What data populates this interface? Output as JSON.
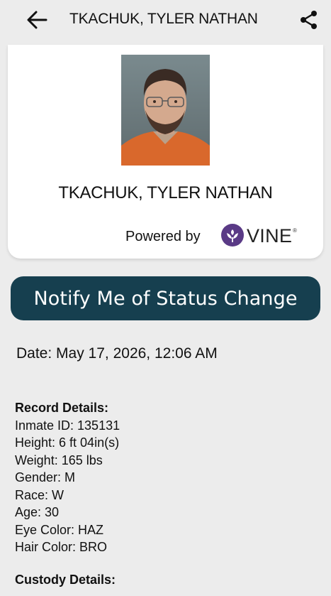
{
  "header": {
    "title": "TKACHUK, TYLER NATHAN"
  },
  "card": {
    "name": "TKACHUK, TYLER NATHAN",
    "powered_by": "Powered by",
    "brand": "VINE",
    "brand_mark": "®",
    "brand_color": "#5a3a86"
  },
  "notify_button": {
    "label": "Notify Me of Status Change",
    "color": "#163f4f"
  },
  "date": {
    "label": "Date:",
    "value": "May 17, 2026, 12:06 AM"
  },
  "record": {
    "heading": "Record Details:",
    "rows": [
      "Inmate ID: 135131",
      "Height: 6 ft 04in(s)",
      "Weight: 165 lbs",
      "Gender: M",
      "Race: W",
      "Age: 30",
      "Eye Color: HAZ",
      "Hair Color: BRO"
    ]
  },
  "custody": {
    "heading": "Custody Details:"
  },
  "icons": {
    "back": "arrow-left-icon",
    "share": "share-icon",
    "vine": "vine-logo-icon"
  }
}
